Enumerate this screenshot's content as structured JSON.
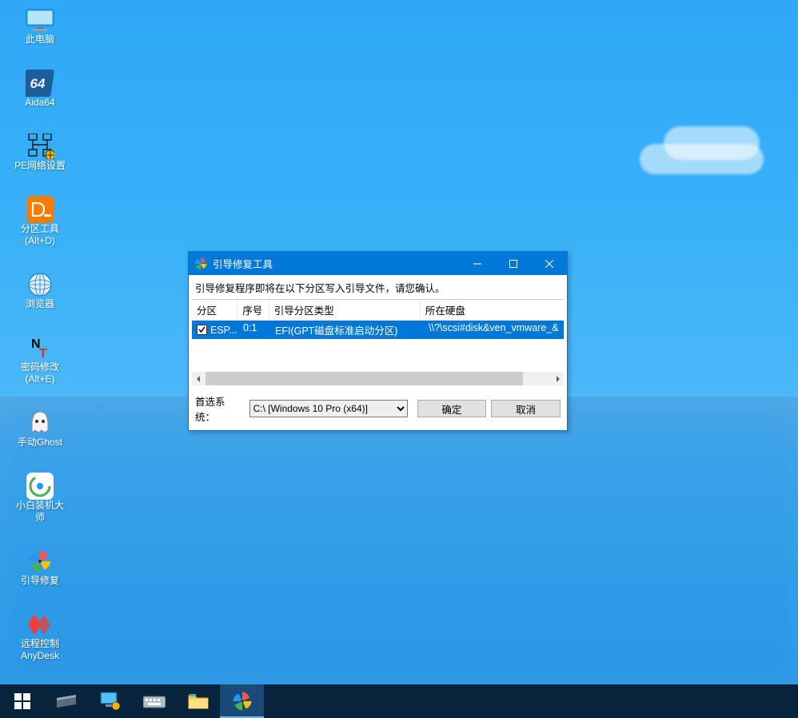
{
  "desktop": {
    "items": [
      {
        "label": "此电脑",
        "icon": "computer-icon"
      },
      {
        "label": "Aida64",
        "icon": "aida64-icon"
      },
      {
        "label": "PE网络设置",
        "icon": "network-config-icon"
      },
      {
        "label": "分区工具\n(Alt+D)",
        "icon": "diskgenius-icon"
      },
      {
        "label": "浏览器",
        "icon": "globe-icon"
      },
      {
        "label": "密码修改\n(Alt+E)",
        "icon": "ntpw-icon"
      },
      {
        "label": "手动Ghost",
        "icon": "ghost-icon"
      },
      {
        "label": "小白装机大\n师",
        "icon": "installer-icon"
      },
      {
        "label": "引导修复",
        "icon": "pinwheel-icon"
      },
      {
        "label": "远程控制\nAnyDesk",
        "icon": "anydesk-icon"
      }
    ]
  },
  "dialog": {
    "title": "引导修复工具",
    "message": "引导修复程序即将在以下分区写入引导文件，请您确认。",
    "columns": [
      "分区",
      "序号",
      "引导分区类型",
      "所在硬盘"
    ],
    "rows": [
      {
        "checked": true,
        "partition": "ESP...",
        "index": "0:1",
        "type": "EFI(GPT磁盘标准启动分区)",
        "disk": "\\\\?\\scsi#disk&ven_vmware_&"
      }
    ],
    "preferred_label": "首选系统：",
    "system_selected": "C:\\ [Windows 10 Pro (x64)]",
    "ok_label": "确定",
    "cancel_label": "取消",
    "minimize_label": "_",
    "maximize_label": "□",
    "close_label": "✕"
  },
  "taskbar": {
    "items": [
      {
        "name": "start",
        "icon": "windows-icon"
      },
      {
        "name": "hwinfo",
        "icon": "chip-icon"
      },
      {
        "name": "netcfg",
        "icon": "monitor-gear-icon"
      },
      {
        "name": "keyboard",
        "icon": "keyboard-icon"
      },
      {
        "name": "explorer",
        "icon": "folder-icon"
      },
      {
        "name": "boot-repair",
        "icon": "pinwheel-icon",
        "active": true
      }
    ]
  }
}
